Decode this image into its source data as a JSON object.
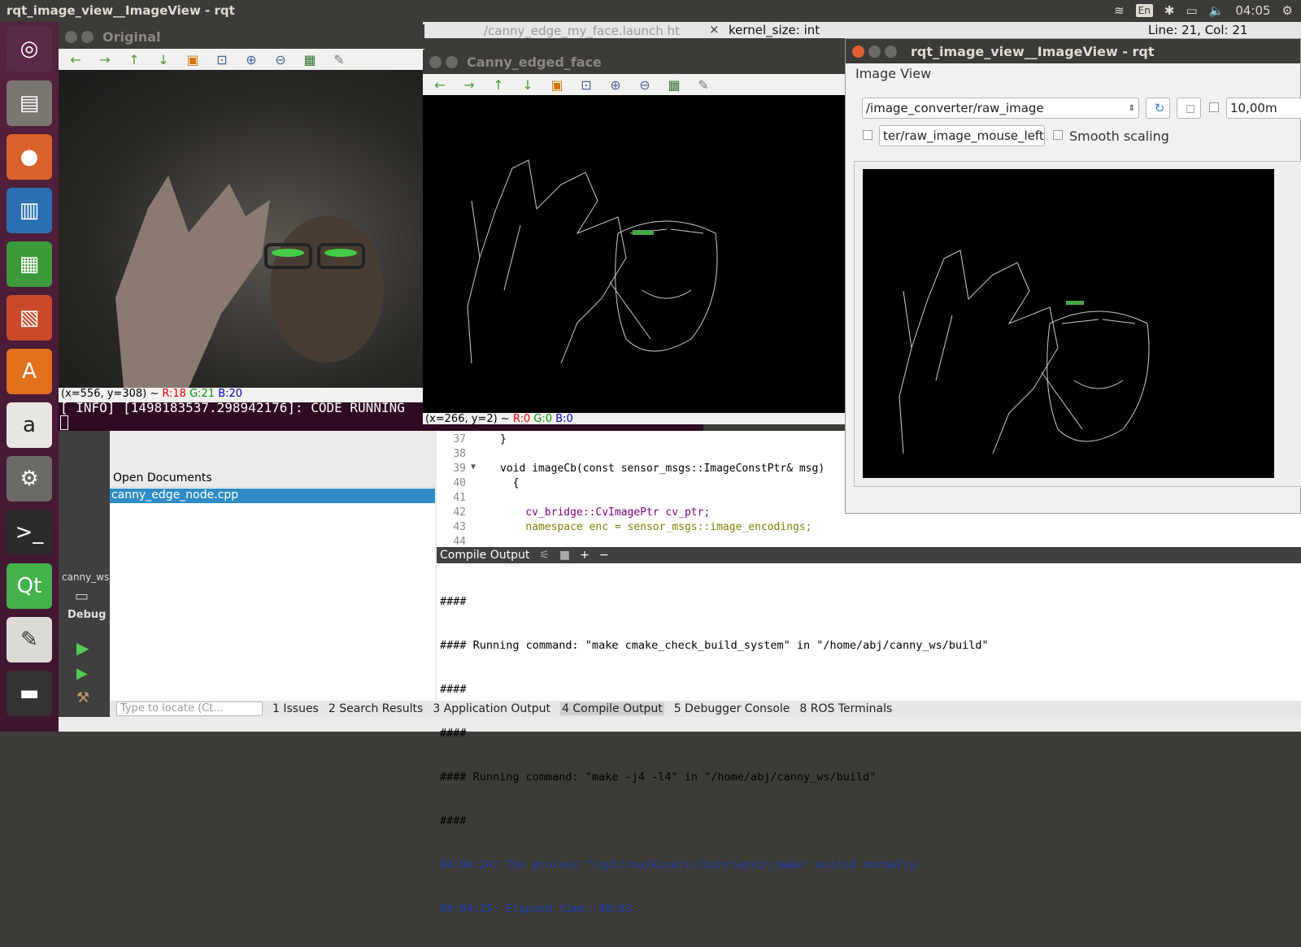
{
  "topbar": {
    "title": "rqt_image_view__ImageView - rqt",
    "lang": "En",
    "time": "04:05"
  },
  "launcher": {
    "icons": [
      "ubuntu-icon",
      "files-icon",
      "firefox-icon",
      "writer-icon",
      "calc-icon",
      "impress-icon",
      "software-center-icon",
      "amazon-icon",
      "settings-icon",
      "terminal-icon",
      "qt-icon",
      "text-editor-icon",
      "screen-icon",
      "help-icon"
    ]
  },
  "original": {
    "title": "Original",
    "status_xy": "(x=556, y=308) ~",
    "r": "R:18",
    "g": "G:21",
    "b": "B:20"
  },
  "launch_tab": {
    "title": "/canny_edge_my_face.launch ht",
    "kernel": "kernel_size: int",
    "linecol": "Line: 21, Col: 21",
    "hash": "#"
  },
  "terminal": {
    "line": "[ INFO] [1498183537.298942176]: CODE RUNNING"
  },
  "canny": {
    "title": "Canny_edged_face",
    "status_xy": "(x=266, y=2) ~",
    "r": "R:0",
    "g": "G:0",
    "b": "B:0"
  },
  "rqt": {
    "title": "rqt_image_view__ImageView - rqt",
    "plugin": "Image View",
    "topic": "/image_converter/raw_image",
    "rate": "10,00m",
    "mouse_topic": "ter/raw_image_mouse_left",
    "smooth": "Smooth scaling"
  },
  "editor": {
    "lines": [
      {
        "n": "37",
        "t": "}"
      },
      {
        "n": "38",
        "t": ""
      },
      {
        "n": "39",
        "t": "void imageCb(const sensor_msgs::ImageConstPtr& msg)"
      },
      {
        "n": "40",
        "t": "  {"
      },
      {
        "n": "41",
        "t": ""
      },
      {
        "n": "42",
        "t": "    cv_bridge::CvImagePtr cv_ptr;"
      },
      {
        "n": "43",
        "t": "    namespace enc = sensor_msgs::image_encodings;"
      },
      {
        "n": "44",
        "t": ""
      }
    ]
  },
  "docs": {
    "header": "Open Documents",
    "file": "canny_edge_node.cpp"
  },
  "sidebar": {
    "project": "canny_ws",
    "mode": "Debug"
  },
  "compile": {
    "header": "Compile Output",
    "lines": [
      "####",
      "#### Running command: \"make cmake_check_build_system\" in \"/home/abj/canny_ws/build\"",
      "####",
      "####",
      "#### Running command: \"make -j4 -l4\" in \"/home/abj/canny_ws/build\"",
      "####"
    ],
    "blue_lines": [
      "04:04:24: The process \"/opt/ros/kinetic/bin/catkin_make\" exited normally.",
      "04:04:25: Elapsed time: 00:03."
    ]
  },
  "bottom": {
    "locate_placeholder": "Type to locate (Ct...",
    "tabs": [
      "1 Issues",
      "2 Search Results",
      "3 Application Output",
      "4 Compile Output",
      "5 Debugger Console",
      "8 ROS Terminals"
    ]
  }
}
